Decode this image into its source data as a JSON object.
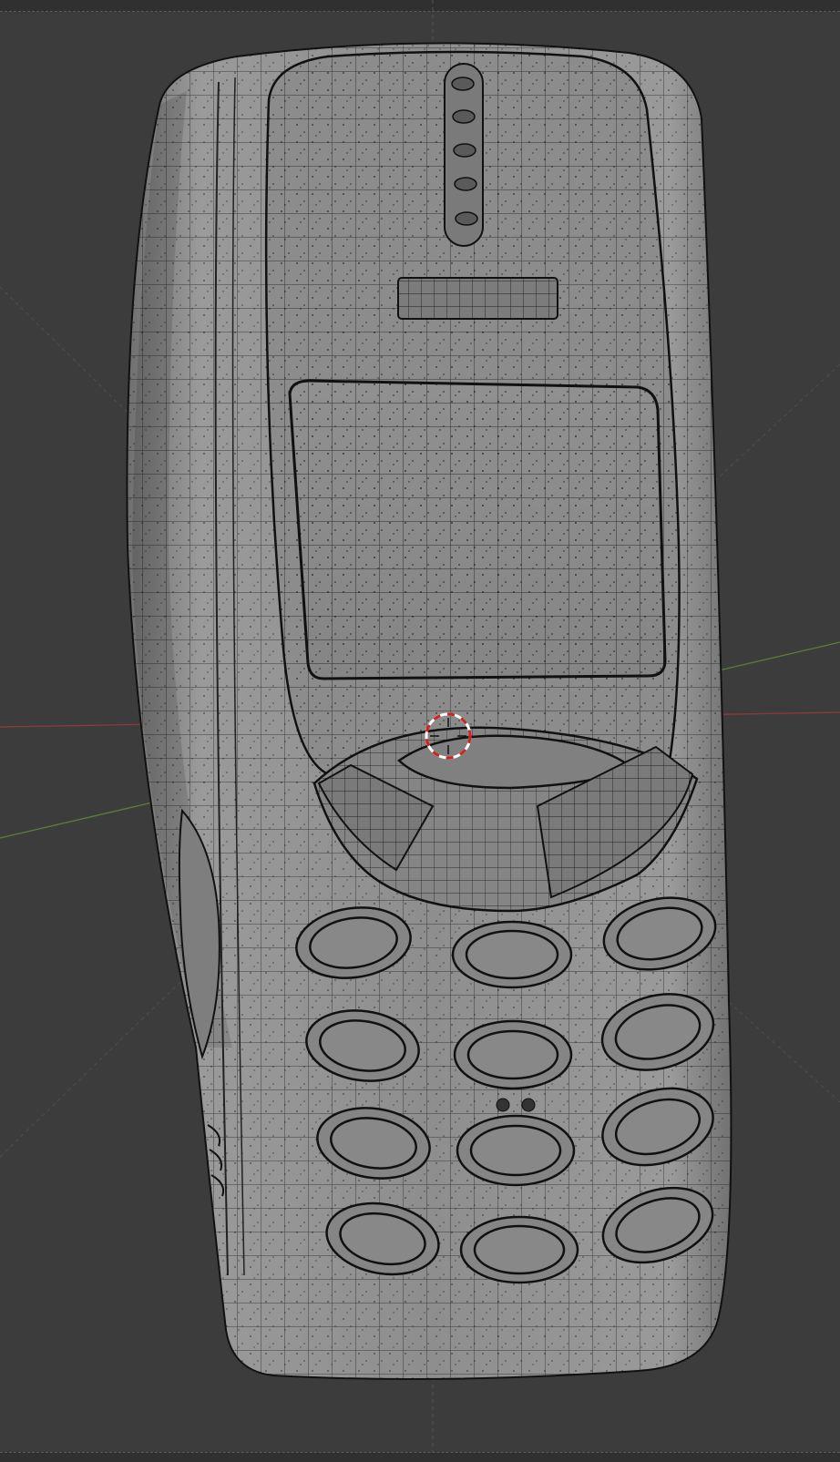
{
  "app": {
    "name": "3D Viewport",
    "shading_mode": "wireframe-overlay"
  },
  "viewport": {
    "background_color": "#3c3c3c",
    "grid_line_color": "#525252",
    "x_axis_color": "#8a3a3a",
    "y_axis_color": "#5a7a3a",
    "object_color": "#8e8e8e",
    "object_shadow_color": "#6e6e6e",
    "wire_color": "#111111"
  },
  "scene": {
    "object": "phone-model",
    "cursor": "3d-cursor"
  }
}
